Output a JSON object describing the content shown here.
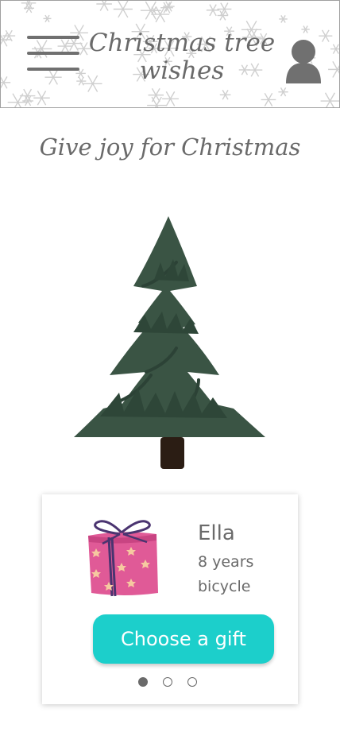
{
  "header": {
    "title": "Christmas tree wishes",
    "menu_icon": "hamburger-menu-icon",
    "profile_icon": "user-profile-icon"
  },
  "tagline": "Give joy for Christmas",
  "wish_card": {
    "name": "Ella",
    "age": "8 years",
    "wish": "bicycle",
    "button_label": "Choose a gift",
    "pagination": {
      "total": 3,
      "active": 1
    }
  },
  "colors": {
    "accent": "#1ccfcb",
    "tree": "#3a5444",
    "trunk": "#2b1d14",
    "gift": "#e05a97",
    "ribbon": "#4a3470",
    "text": "#6a6a6a"
  }
}
